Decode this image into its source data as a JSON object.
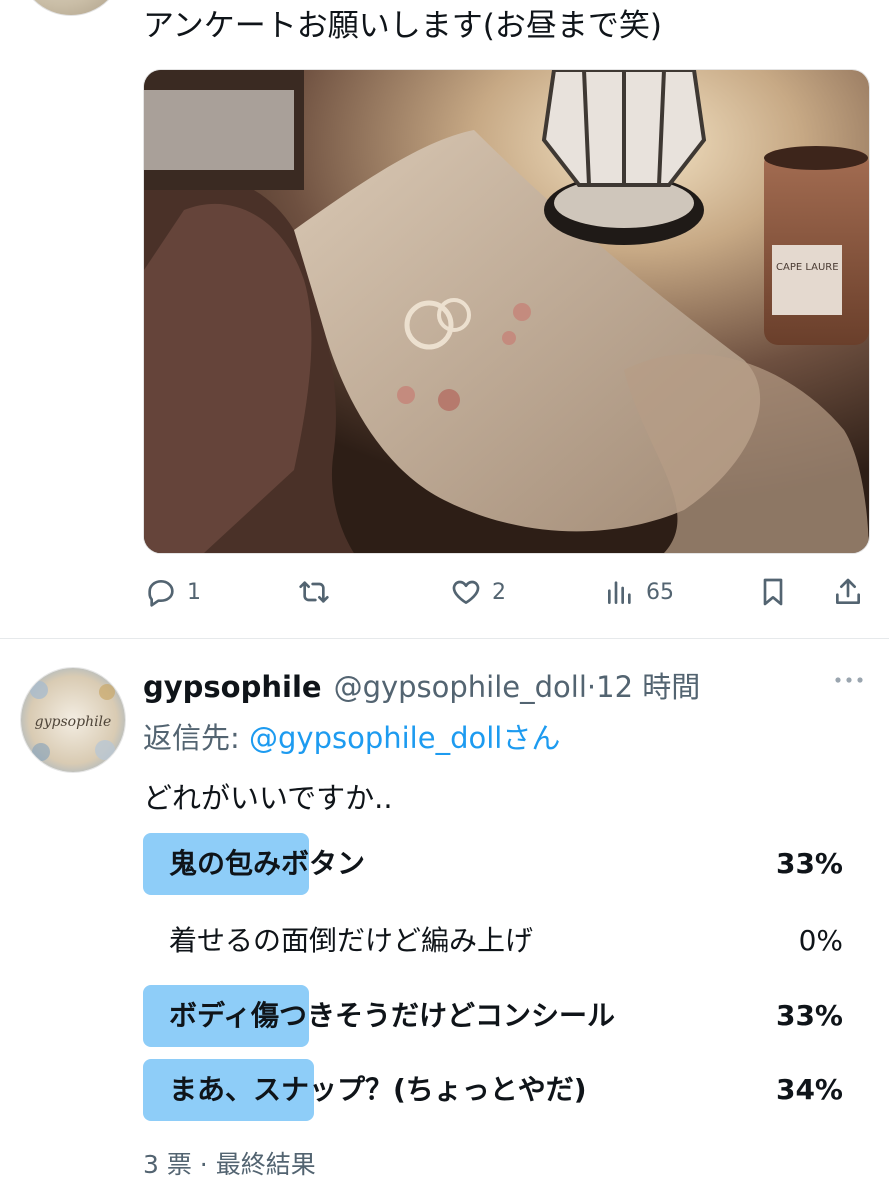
{
  "tweet1": {
    "text": "アンケートお願いします(お昼まで笑)",
    "photo_alt": "",
    "photo_text": "CAPE LAURE",
    "actions": {
      "reply_count": "1",
      "retweet_count": "",
      "like_count": "2",
      "view_count": "65"
    },
    "icons": [
      "reply-icon",
      "retweet-icon",
      "like-icon",
      "views-icon",
      "bookmark-icon",
      "share-icon"
    ]
  },
  "tweet2": {
    "avatar_text": "gypsophile",
    "display_name": "gypsophile",
    "handle": "@gypsophile_doll",
    "separator": "·",
    "time": "12 時間",
    "reply_prefix": "返信先:",
    "reply_mention": "@gypsophile_doll",
    "reply_suffix": "さん",
    "text": "どれがいいですか..",
    "poll": {
      "options": [
        {
          "label": "鬼の包みボタン",
          "percent_text": "33%",
          "percent": 33,
          "leading": false
        },
        {
          "label": "着せるの面倒だけど編み上げ",
          "percent_text": "0%",
          "percent": 0,
          "leading": false
        },
        {
          "label": "ボディ傷つきそうだけどコンシール",
          "percent_text": "33%",
          "percent": 33,
          "leading": false
        },
        {
          "label": "まあ、スナップ？(ちょっとやだ)",
          "percent_text": "34%",
          "percent": 34,
          "leading": true
        }
      ],
      "footer": "3 票 · 最終結果"
    }
  },
  "colors": {
    "text": "#0f1419",
    "secondary": "#536471",
    "link": "#1d9bf0",
    "poll_bar": "#8ecdf8"
  }
}
